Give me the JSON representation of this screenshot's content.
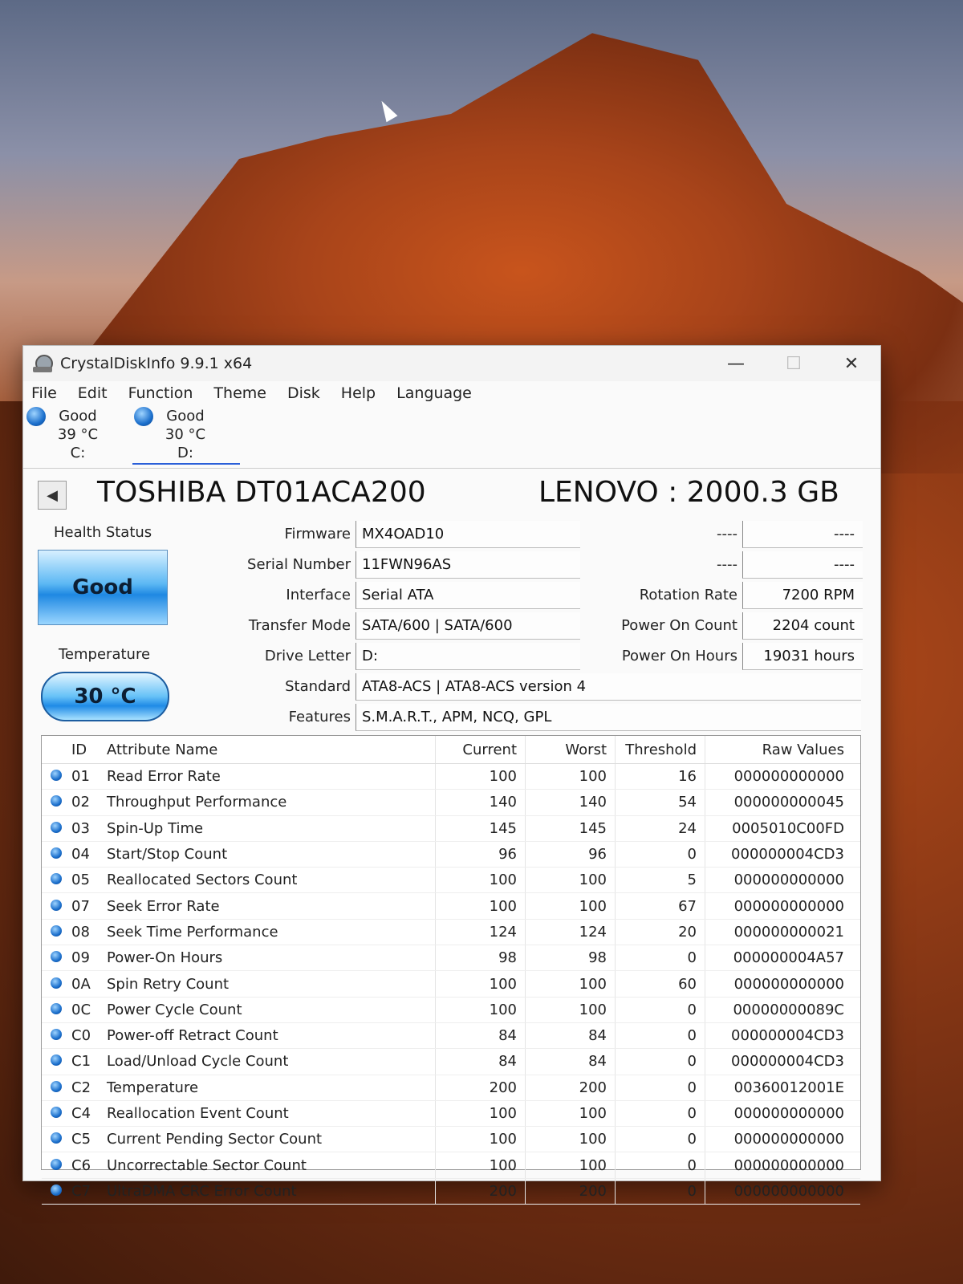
{
  "window": {
    "title": "CrystalDiskInfo 9.9.1 x64",
    "minimize": "—",
    "maximize": "☐",
    "close": "✕"
  },
  "menu": [
    "File",
    "Edit",
    "Function",
    "Theme",
    "Disk",
    "Help",
    "Language"
  ],
  "drives": [
    {
      "status": "Good",
      "temp": "39 °C",
      "letter": "C:"
    },
    {
      "status": "Good",
      "temp": "30 °C",
      "letter": "D:"
    }
  ],
  "disk": {
    "model": "TOSHIBA DT01ACA200",
    "capacity": "LENOVO : 2000.3 GB",
    "back_icon": "◀"
  },
  "health": {
    "label": "Health Status",
    "value": "Good"
  },
  "temperature": {
    "label": "Temperature",
    "value": "30 °C"
  },
  "info": {
    "firmware": {
      "label": "Firmware",
      "value": "MX4OAD10"
    },
    "serial": {
      "label": "Serial Number",
      "value": "11FWN96AS"
    },
    "interface": {
      "label": "Interface",
      "value": "Serial ATA"
    },
    "transfer": {
      "label": "Transfer Mode",
      "value": "SATA/600 | SATA/600"
    },
    "drive_letter": {
      "label": "Drive Letter",
      "value": "D:"
    },
    "standard": {
      "label": "Standard",
      "value": "ATA8-ACS | ATA8-ACS version 4"
    },
    "features": {
      "label": "Features",
      "value": "S.M.A.R.T., APM, NCQ, GPL"
    },
    "right1": {
      "label": "----",
      "value": "----"
    },
    "right2": {
      "label": "----",
      "value": "----"
    },
    "rotation": {
      "label": "Rotation Rate",
      "value": "7200 RPM"
    },
    "power_count": {
      "label": "Power On Count",
      "value": "2204 count"
    },
    "power_hours": {
      "label": "Power On Hours",
      "value": "19031 hours"
    }
  },
  "smart": {
    "headers": {
      "id": "ID",
      "name": "Attribute Name",
      "current": "Current",
      "worst": "Worst",
      "threshold": "Threshold",
      "raw": "Raw Values"
    },
    "rows": [
      {
        "id": "01",
        "name": "Read Error Rate",
        "current": "100",
        "worst": "100",
        "threshold": "16",
        "raw": "000000000000"
      },
      {
        "id": "02",
        "name": "Throughput Performance",
        "current": "140",
        "worst": "140",
        "threshold": "54",
        "raw": "000000000045"
      },
      {
        "id": "03",
        "name": "Spin-Up Time",
        "current": "145",
        "worst": "145",
        "threshold": "24",
        "raw": "0005010C00FD"
      },
      {
        "id": "04",
        "name": "Start/Stop Count",
        "current": "96",
        "worst": "96",
        "threshold": "0",
        "raw": "000000004CD3"
      },
      {
        "id": "05",
        "name": "Reallocated Sectors Count",
        "current": "100",
        "worst": "100",
        "threshold": "5",
        "raw": "000000000000"
      },
      {
        "id": "07",
        "name": "Seek Error Rate",
        "current": "100",
        "worst": "100",
        "threshold": "67",
        "raw": "000000000000"
      },
      {
        "id": "08",
        "name": "Seek Time Performance",
        "current": "124",
        "worst": "124",
        "threshold": "20",
        "raw": "000000000021"
      },
      {
        "id": "09",
        "name": "Power-On Hours",
        "current": "98",
        "worst": "98",
        "threshold": "0",
        "raw": "000000004A57"
      },
      {
        "id": "0A",
        "name": "Spin Retry Count",
        "current": "100",
        "worst": "100",
        "threshold": "60",
        "raw": "000000000000"
      },
      {
        "id": "0C",
        "name": "Power Cycle Count",
        "current": "100",
        "worst": "100",
        "threshold": "0",
        "raw": "00000000089C"
      },
      {
        "id": "C0",
        "name": "Power-off Retract Count",
        "current": "84",
        "worst": "84",
        "threshold": "0",
        "raw": "000000004CD3"
      },
      {
        "id": "C1",
        "name": "Load/Unload Cycle Count",
        "current": "84",
        "worst": "84",
        "threshold": "0",
        "raw": "000000004CD3"
      },
      {
        "id": "C2",
        "name": "Temperature",
        "current": "200",
        "worst": "200",
        "threshold": "0",
        "raw": "00360012001E"
      },
      {
        "id": "C4",
        "name": "Reallocation Event Count",
        "current": "100",
        "worst": "100",
        "threshold": "0",
        "raw": "000000000000"
      },
      {
        "id": "C5",
        "name": "Current Pending Sector Count",
        "current": "100",
        "worst": "100",
        "threshold": "0",
        "raw": "000000000000"
      },
      {
        "id": "C6",
        "name": "Uncorrectable Sector Count",
        "current": "100",
        "worst": "100",
        "threshold": "0",
        "raw": "000000000000"
      },
      {
        "id": "C7",
        "name": "UltraDMA CRC Error Count",
        "current": "200",
        "worst": "200",
        "threshold": "0",
        "raw": "000000000000"
      }
    ]
  }
}
